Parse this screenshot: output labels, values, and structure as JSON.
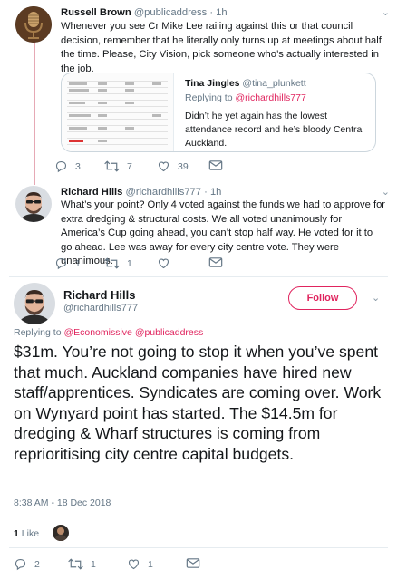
{
  "tweet1": {
    "name": "Russell Brown",
    "handle": "@publicaddress",
    "separator": "·",
    "time": "1h",
    "text": "Whenever you see Cr Mike Lee railing against this or that council decision, remember that he literally only turns up at meetings about half the time. Please, City Vision, pick someone who’s actually interested in the job.",
    "quoted": {
      "name": "Tina Jingles",
      "handle": "@tina_plunkett",
      "replying_prefix": "Replying to ",
      "replying_handle": "@richardhills777",
      "text": "Didn’t he yet again has the lowest attendance record and he’s bloody Central Auckland."
    },
    "actions": {
      "replies": "3",
      "retweets": "7",
      "likes": "39"
    }
  },
  "tweet2": {
    "name": "Richard Hills",
    "handle": "@richardhills777",
    "separator": "·",
    "time": "1h",
    "text": "What’s your point? Only 4 voted against the funds we had to approve for extra dredging & structural costs. We all voted unanimously for America’s Cup going ahead, you can’t stop half way. He voted for it to go ahead. Lee was away for every city centre vote. They were unanimous.",
    "actions": {
      "replies": "1",
      "retweets": "1",
      "likes": ""
    }
  },
  "main": {
    "name": "Richard Hills",
    "handle": "@richardhills777",
    "follow_label": "Follow",
    "replying_prefix": "Replying to ",
    "replying_to_1": "@Economissive",
    "replying_to_2": "@publicaddress",
    "text": "$31m. You’re not going to stop it when you’ve spent that much. Auckland companies have hired new staff/apprentices. Syndicates are coming over. Work on Wynyard point has started. The $14.5m for dredging & Wharf structures is coming from reprioritising city centre capital budgets.",
    "timestamp": "8:38 AM - 18 Dec 2018",
    "likes_count": "1",
    "likes_label": "Like",
    "actions": {
      "replies": "2",
      "retweets": "1",
      "likes": "1"
    }
  },
  "colors": {
    "accent": "#e0245e",
    "muted": "#657786",
    "border": "#e6ecf0",
    "thread": "#e6a9b5"
  },
  "icons": [
    "microphone-avatar",
    "reply-icon",
    "retweet-icon",
    "like-icon",
    "mail-icon",
    "chevron-down-icon"
  ]
}
